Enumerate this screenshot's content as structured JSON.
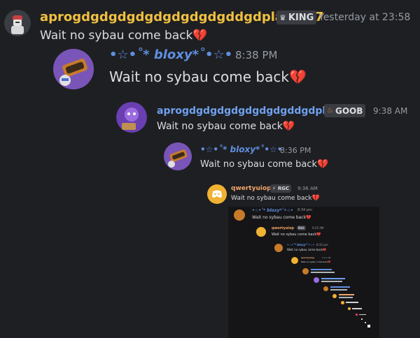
{
  "messages": [
    {
      "username": "aprogdgdgdgdgdgdgdgdgddgdplayer67",
      "badge": "KING",
      "timestamp": "Yesterday at 23:58",
      "text": "Wait no sybau come back",
      "emoji": "💔"
    },
    {
      "username": "•☆•˚* bloxy*˚•☆•",
      "timestamp": "8:38 PM",
      "text": "Wait no sybau come back",
      "emoji": "💔"
    },
    {
      "username": "aprogdgdgdgdgdgdgdgddgdpl...",
      "badge": "GOOB",
      "timestamp": "9:38 AM",
      "text": "Wait no sybau come back",
      "emoji": "💔"
    },
    {
      "username": "•☆•˚* bloxy*˚•☆•",
      "timestamp": "8:36 PM",
      "text": "Wait no sybau come back",
      "emoji": "💔"
    },
    {
      "username": "qwertyuiop",
      "badge": "RGC",
      "timestamp": "9:36 AM",
      "text": "Wait no sybau come back",
      "emoji": "💔"
    },
    {
      "username": "•☆•˚* bloxy*˚•☆•",
      "timestamp": "8:34 pm",
      "text": "Wait no sybau come back",
      "emoji": "💔"
    },
    {
      "username": "qwertyuiop",
      "badge": "RGC",
      "timestamp": "9:35 AM",
      "text": "Wait no sybau come back",
      "emoji": "💔"
    },
    {
      "username": "•☆•˚* bloxy*˚•☆•",
      "timestamp": "8:32 pm",
      "text": "Wait no sybau come back",
      "emoji": "💔"
    },
    {
      "username": "qwertyuiop",
      "badge": "RGC",
      "timestamp": "9:34 AM",
      "text": "Wait no sybau come back",
      "emoji": "💔"
    }
  ]
}
